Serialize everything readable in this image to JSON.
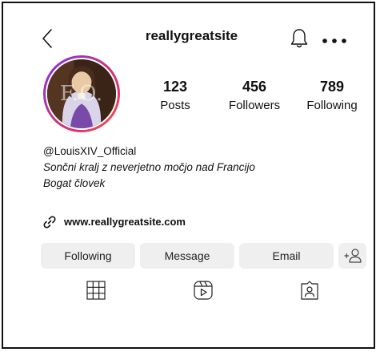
{
  "header": {
    "username": "reallygreatsite",
    "back_icon": "chevron-left-icon",
    "bell_icon": "bell-icon",
    "more_icon": "more-horizontal-icon"
  },
  "profile": {
    "avatar_monogram": "F.O.",
    "stats": [
      {
        "value": "123",
        "label": "Posts"
      },
      {
        "value": "456",
        "label": "Followers"
      },
      {
        "value": "789",
        "label": "Following"
      }
    ],
    "bio": {
      "handle": "@LouisXIV_Official",
      "line1": "Sončni kralj z neverjetno močjo nad Francijo",
      "line2": "Bogat človek"
    },
    "link": "www.reallygreatsite.com"
  },
  "actions": {
    "following": "Following",
    "message": "Message",
    "email": "Email"
  },
  "tabs": [
    "grid-icon",
    "reels-icon",
    "tagged-icon"
  ],
  "colors": {
    "button_bg": "#efefef",
    "ring_start": "#7b2ff7",
    "ring_end": "#f56040"
  }
}
